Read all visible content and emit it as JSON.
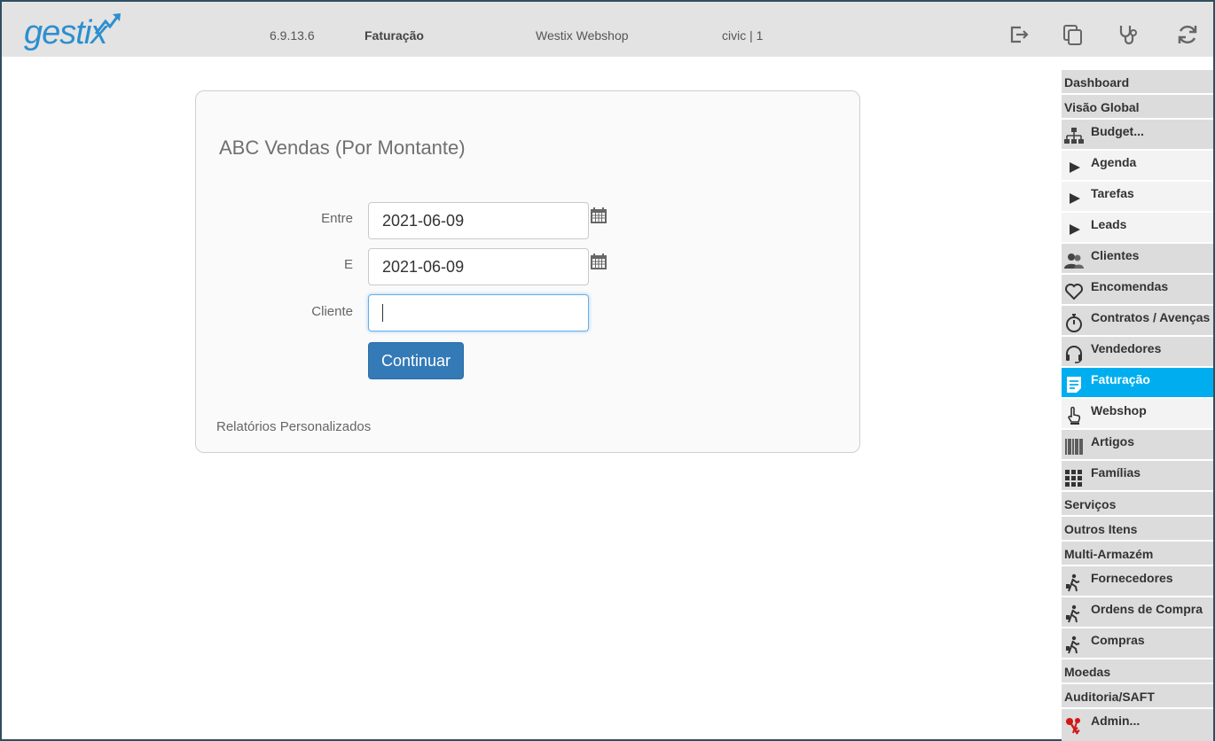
{
  "header": {
    "logo_text": "gestix",
    "version": "6.9.13.6",
    "module": "Faturação",
    "shop": "Westix Webshop",
    "user": "civic | 1",
    "icons": [
      "logout-icon",
      "copy-windows-icon",
      "stethoscope-icon",
      "refresh-icon"
    ],
    "logo_color": "#2b8fcf"
  },
  "sidebar": {
    "active_color": "#00aeef",
    "items": [
      {
        "label": "Dashboard",
        "icon": ""
      },
      {
        "label": "Visão Global",
        "icon": ""
      },
      {
        "label": "Budget...",
        "icon": "org-chart-icon"
      },
      {
        "label": "Agenda",
        "icon": "play-icon"
      },
      {
        "label": "Tarefas",
        "icon": "play-icon"
      },
      {
        "label": "Leads",
        "icon": "play-icon"
      },
      {
        "label": "Clientes",
        "icon": "users-icon"
      },
      {
        "label": "Encomendas",
        "icon": "heart-icon"
      },
      {
        "label": "Contratos / Avenças",
        "icon": "stopwatch-icon"
      },
      {
        "label": "Vendedores",
        "icon": "headset-icon"
      },
      {
        "label": "Faturação",
        "icon": "document-icon"
      },
      {
        "label": "Webshop",
        "icon": "hand-pointer-icon"
      },
      {
        "label": "Artigos",
        "icon": "barcode-icon"
      },
      {
        "label": "Famílias",
        "icon": "grid-icon"
      },
      {
        "label": "Serviços",
        "icon": ""
      },
      {
        "label": "Outros Itens",
        "icon": ""
      },
      {
        "label": "Multi-Armazém",
        "icon": ""
      },
      {
        "label": "Fornecedores",
        "icon": "walking-person-icon"
      },
      {
        "label": "Ordens de Compra",
        "icon": "walking-person-icon"
      },
      {
        "label": "Compras",
        "icon": "walking-person-icon"
      },
      {
        "label": "Moedas",
        "icon": ""
      },
      {
        "label": "Auditoria/SAFT",
        "icon": ""
      },
      {
        "label": "Admin...",
        "icon": "keys-icon"
      }
    ]
  },
  "report": {
    "title": "ABC Vendas (Por Montante)",
    "fields": {
      "start_label": "Entre",
      "start_value": "2021-06-09",
      "end_label": "E",
      "end_value": "2021-06-09",
      "client_label": "Cliente",
      "client_value": ""
    },
    "continue_label": "Continuar",
    "footer_link": "Relatórios Personalizados",
    "button_color": "#337ab7"
  }
}
